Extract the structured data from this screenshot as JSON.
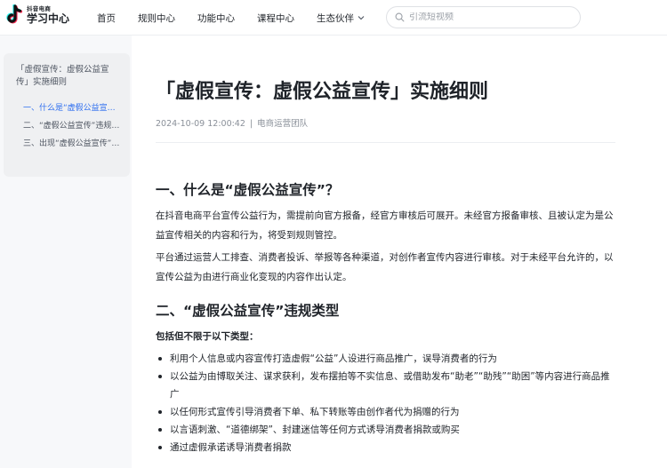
{
  "header": {
    "logo_small": "抖音电商",
    "logo_big": "学习中心",
    "nav": [
      {
        "label": "首页"
      },
      {
        "label": "规则中心"
      },
      {
        "label": "功能中心"
      },
      {
        "label": "课程中心"
      },
      {
        "label": "生态伙伴"
      }
    ],
    "search_placeholder": "引流短视频"
  },
  "toc": {
    "title": "「虚假宣传：虚假公益宣传」实施细则",
    "items": [
      {
        "label": "一、什么是“虚假公益宣传”？"
      },
      {
        "label": "二、“虚假公益宣传”违规类型"
      },
      {
        "label": "三、出现“虚假公益宣传”行为将会受到的处罚"
      }
    ]
  },
  "article": {
    "title": "「虚假宣传：虚假公益宣传」实施细则",
    "date": "2024-10-09 12:00:42",
    "separator": "|",
    "author": "电商运营团队",
    "section1_heading": "一、什么是“虚假公益宣传”？",
    "section1_p1": "在抖音电商平台宣传公益行为，需提前向官方报备，经官方审核后可展开。未经官方报备审核、且被认定为是公益宣传相关的内容和行为，将受到规则管控。",
    "section1_p2": "平台通过运营人工排查、消费者投诉、举报等各种渠道，对创作者宣传内容进行审核。对于未经平台允许的，以宣传公益为由进行商业化变现的内容作出认定。",
    "section2_heading": "二、“虚假公益宣传”违规类型",
    "section2_lead": "包括但不限于以下类型：",
    "bullets": [
      "利用个人信息或内容宣传打造虚假“公益”人设进行商品推广，误导消费者的行为",
      "以公益为由博取关注、谋求获利，发布摆拍等不实信息、或借助发布“助老”“助残”“助困”等内容进行商品推广",
      "以任何形式宣传引导消费者下单、私下转账等由创作者代为捐赠的行为",
      "以言语刺激、“道德绑架”、封建迷信等任何方式诱导消费者捐款或购买",
      "通过虚假承诺诱导消费者捐款"
    ]
  }
}
